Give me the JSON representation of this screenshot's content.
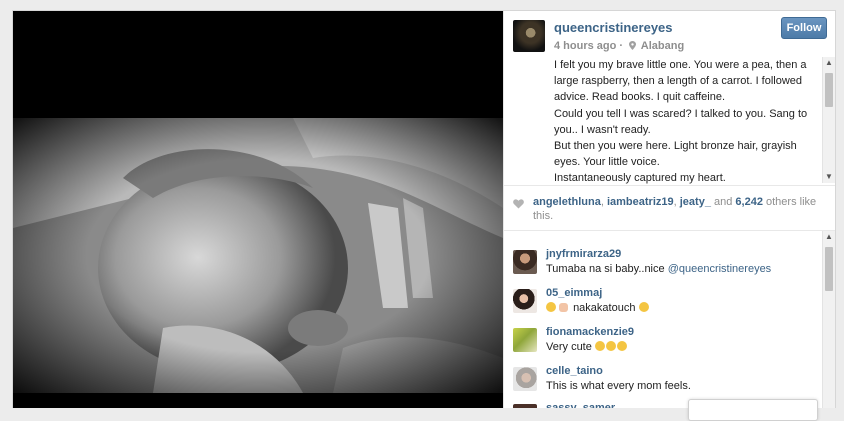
{
  "post": {
    "username": "queencristinereyes",
    "time": "4 hours ago",
    "separator": "·",
    "location": "Alabang",
    "follow_label": "Follow",
    "caption_lines": [
      "I felt you my brave little one. You were a pea, then a large raspberry, then a length of a carrot. I followed advice. Read books. I quit caffeine.",
      "Could you tell I was scared? I talked to you. Sang to you.. I wasn't ready.",
      "But then you were here. Light bronze hair, grayish eyes. Your little voice.",
      "Instantaneously captured my heart."
    ]
  },
  "likes": {
    "user1": "angelethluna",
    "sep1": ",",
    "user2": "iambeatriz19",
    "sep2": ",",
    "user3": "jeaty_",
    "and": " and ",
    "count": "6,242",
    "suffix": " others like this."
  },
  "comments": [
    {
      "user": "jnyfrmirarza29",
      "text": "Tumaba na si baby..nice ",
      "mention": "@queencristinereyes"
    },
    {
      "user": "05_eimmaj",
      "text": "nakakatouch",
      "emoji_before": "😍",
      "emoji_after": "😍"
    },
    {
      "user": "fionamackenzie9",
      "text": "Very cute ",
      "emoji_after": "😍😍😍"
    },
    {
      "user": "celle_taino",
      "text": "This is what every mom feels."
    },
    {
      "user": "sassy_samer",
      "text": ""
    }
  ],
  "icons": {
    "location": "location-pin-icon",
    "like": "heart-icon",
    "scroll_up": "arrow-up-icon",
    "scroll_down": "arrow-down-icon"
  },
  "colors": {
    "link": "#3d6487",
    "follow_button": "#5a87b4",
    "muted": "#8e8e8e"
  }
}
